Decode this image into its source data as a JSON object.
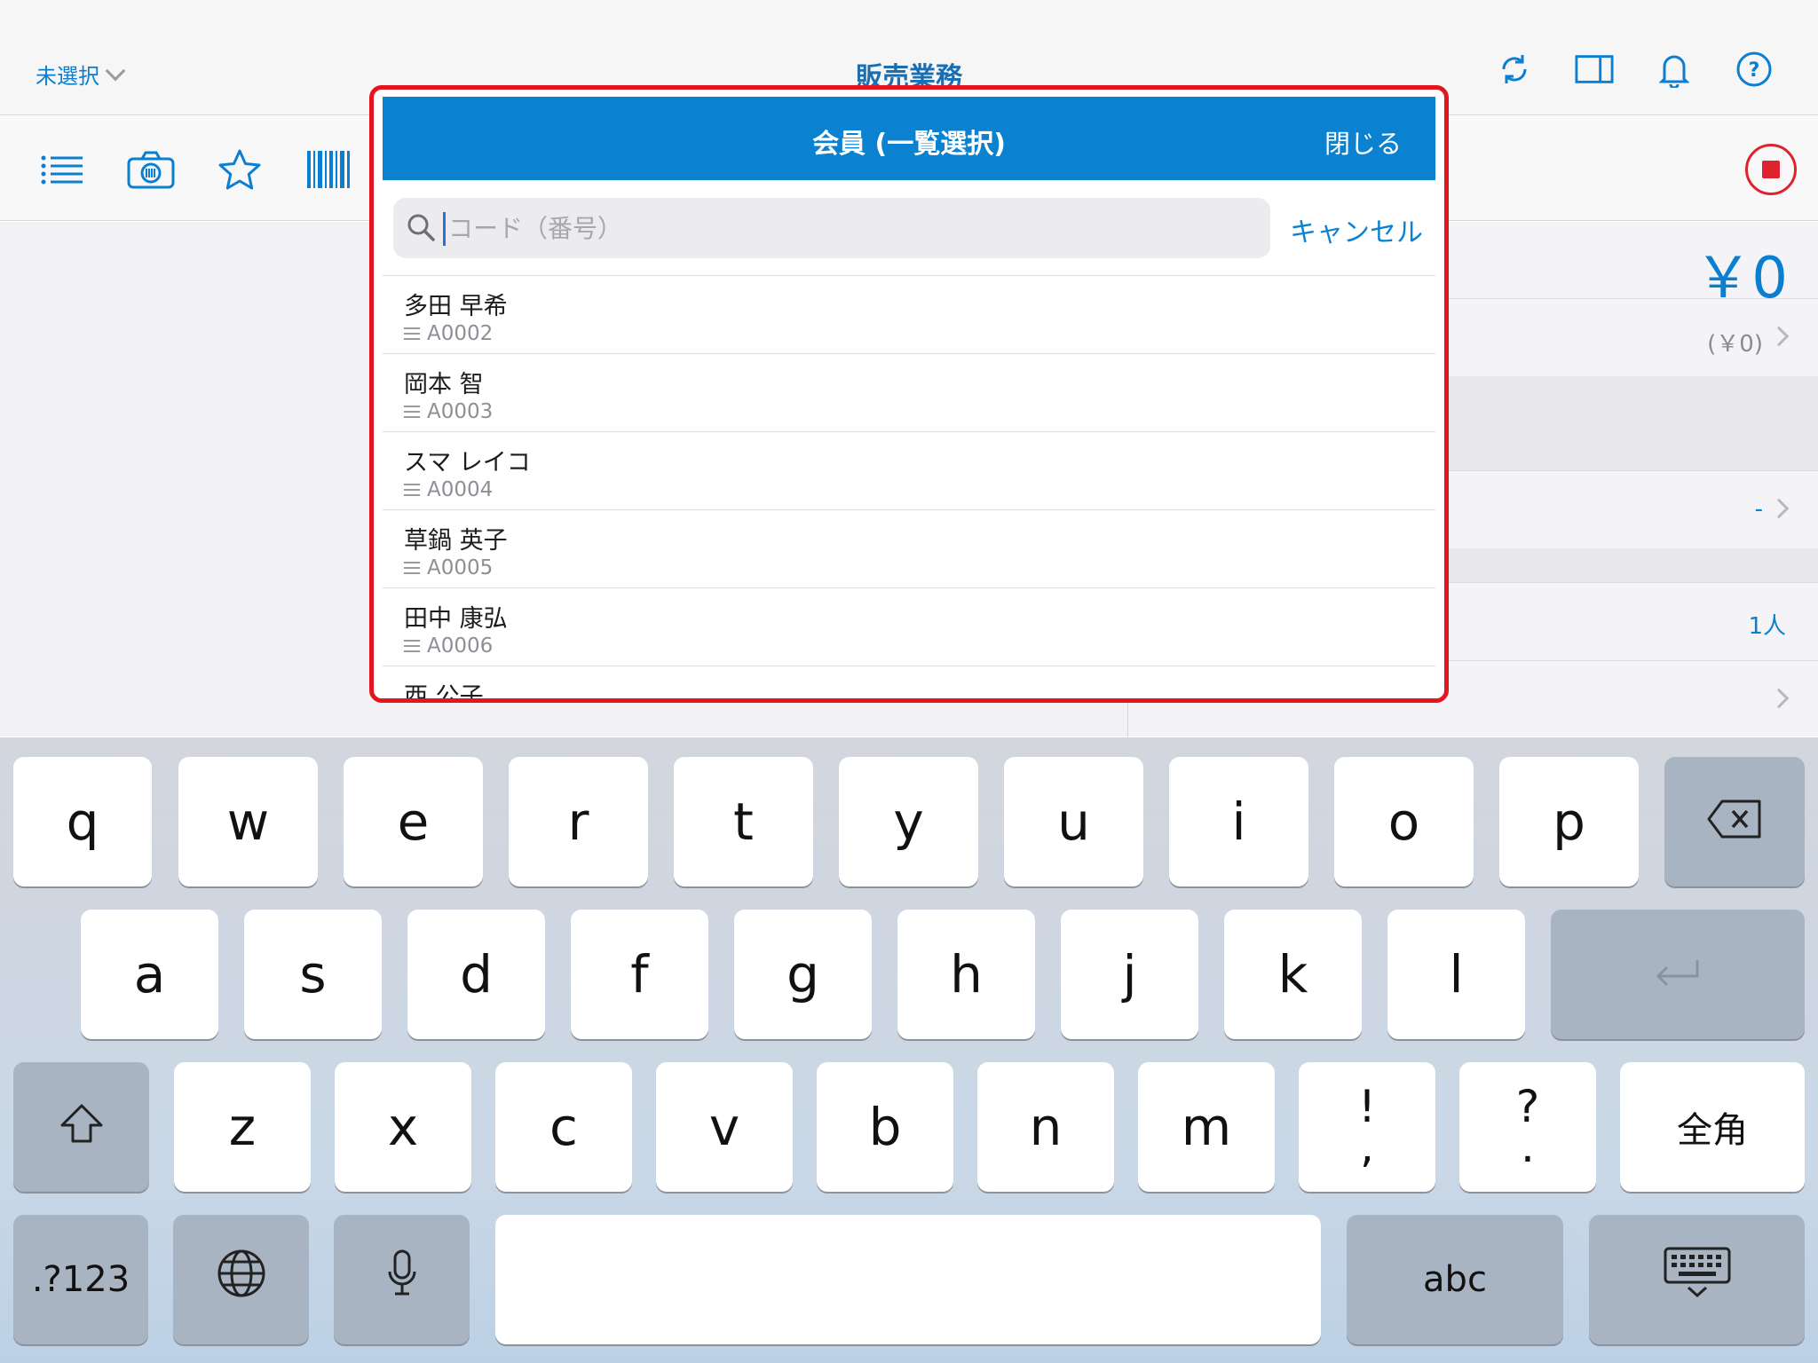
{
  "header": {
    "store_select": "未選択",
    "title": "販売業務",
    "icons": [
      "refresh-icon",
      "split-view-icon",
      "bell-icon",
      "help-icon"
    ]
  },
  "toolbar": {
    "icons": [
      "list-icon",
      "camera-icon",
      "star-icon",
      "barcode-icon",
      "record-stop-icon"
    ]
  },
  "right_panel": {
    "total": "￥0",
    "subtotal": "(￥0)",
    "staff_value": "-",
    "people_count": "1人"
  },
  "popover": {
    "title": "会員 (一覧選択)",
    "close_label": "閉じる",
    "search": {
      "value": "",
      "placeholder": "コード（番号）",
      "cancel_label": "キャンセル"
    },
    "members": [
      {
        "name": "多田 早希",
        "code": "A0002"
      },
      {
        "name": "岡本 智",
        "code": "A0003"
      },
      {
        "name": "スマ レイコ",
        "code": "A0004"
      },
      {
        "name": "草鍋 英子",
        "code": "A0005"
      },
      {
        "name": "田中 康弘",
        "code": "A0006"
      },
      {
        "name": "西 公子",
        "code": ""
      }
    ]
  },
  "keyboard": {
    "row1": [
      "q",
      "w",
      "e",
      "r",
      "t",
      "y",
      "u",
      "i",
      "o",
      "p"
    ],
    "row2": [
      "a",
      "s",
      "d",
      "f",
      "g",
      "h",
      "j",
      "k",
      "l"
    ],
    "row3": [
      "z",
      "x",
      "c",
      "v",
      "b",
      "n",
      "m"
    ],
    "punct1_top": "!",
    "punct1_bottom": ",",
    "punct2_top": "?",
    "punct2_bottom": ".",
    "fullwidth_label": "全角",
    "numbers_label": ".?123",
    "abc_label": "abc",
    "key_icons": [
      "delete-icon",
      "return-icon",
      "shift-icon",
      "globe-icon",
      "microphone-icon",
      "keyboard-dismiss-icon"
    ]
  }
}
